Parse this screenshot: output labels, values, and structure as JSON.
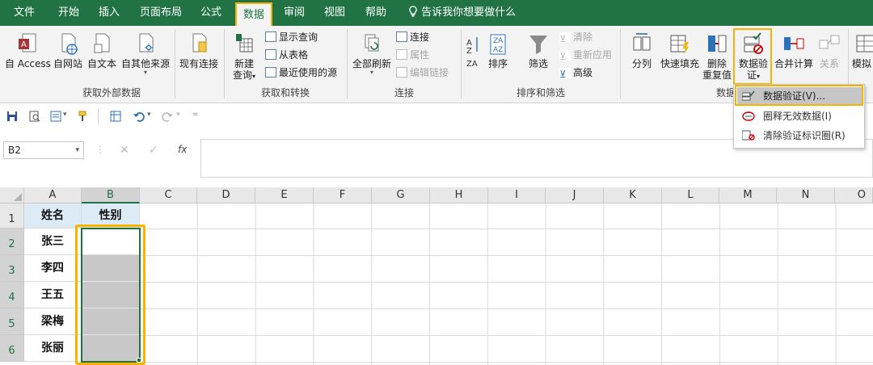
{
  "menu": {
    "tabs": [
      "文件",
      "开始",
      "插入",
      "页面布局",
      "公式",
      "数据",
      "审阅",
      "视图",
      "帮助"
    ],
    "active_tab": "数据",
    "tell_me": "告诉我你想要做什么"
  },
  "ribbon": {
    "groups": [
      "获取外部数据",
      "获取和转换",
      "连接",
      "排序和筛选",
      "数据"
    ],
    "get_external": {
      "access": "自 Access",
      "web": "自网站",
      "text": "自文本",
      "other": "自其他来源",
      "existing": "现有连接"
    },
    "get_transform": {
      "new_query_line1": "新建",
      "new_query_line2": "查询",
      "show_queries": "显示查询",
      "from_table": "从表格",
      "recent_sources": "最近使用的源"
    },
    "connections": {
      "refresh_all": "全部刷新",
      "connections": "连接",
      "properties": "属性",
      "edit_links": "编辑链接"
    },
    "sort_filter": {
      "sort": "排序",
      "filter": "筛选",
      "clear": "清除",
      "reapply": "重新应用",
      "advanced": "高级"
    },
    "data_tools": {
      "text_to_columns": "分列",
      "flash_fill": "快速填充",
      "remove_dup_line1": "删除",
      "remove_dup_line2": "重复值",
      "validation_line1": "数据验",
      "validation_line2": "证",
      "consolidate": "合并计算",
      "relationships": "关系",
      "whatif": "模拟"
    }
  },
  "formula_bar": {
    "name_box": "B2",
    "fx": "fx",
    "value": ""
  },
  "grid": {
    "columns": [
      "A",
      "B",
      "C",
      "D",
      "E",
      "F",
      "G",
      "H",
      "I",
      "J",
      "K",
      "L",
      "M",
      "N",
      "O"
    ],
    "rows": [
      "1",
      "2",
      "3",
      "4",
      "5",
      "6"
    ],
    "selected_column": "B",
    "cells_A": [
      "姓名",
      "张三",
      "李四",
      "王五",
      "梁梅",
      "张丽"
    ],
    "cells_B": [
      "性别",
      "",
      "",
      "",
      "",
      ""
    ]
  },
  "dropdown": {
    "items": [
      "数据验证(V)...",
      "圈释无效数据(I)",
      "清除验证标识圈(R)"
    ]
  },
  "colors": {
    "brand_green": "#217346",
    "highlight": "#f5b400",
    "header_fill": "#ddebf7",
    "gray_fill": "#c8c8c8"
  }
}
